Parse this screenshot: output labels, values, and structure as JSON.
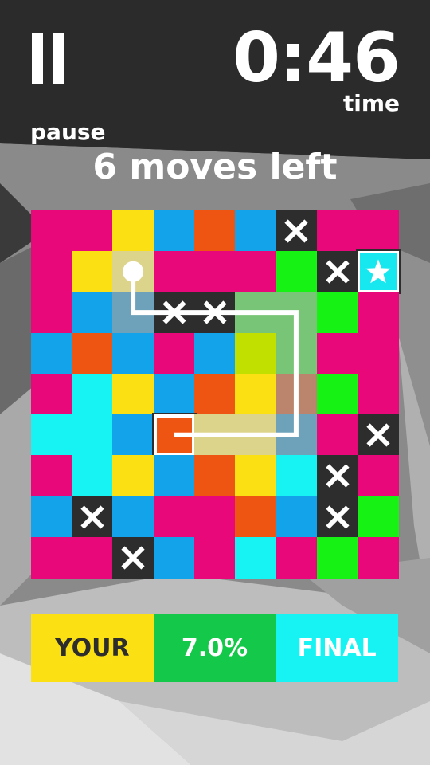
{
  "colors": {
    "pink": "#e8087a",
    "yellow": "#fbe014",
    "blue": "#12a3ea",
    "orange": "#ef5512",
    "green": "#15f214",
    "cyan": "#17f3f3",
    "dark": "#2d2d2d",
    "lime": "#c2e000"
  },
  "hud": {
    "pause_label": "pause",
    "timer_value": "0:46",
    "timer_label": "time",
    "moves_text": "6 moves left"
  },
  "board": {
    "size": 9,
    "rows": [
      [
        "pink",
        "pink",
        "yellow",
        "blue",
        "orange",
        "blue",
        "x",
        "pink",
        "pink"
      ],
      [
        "pink",
        "yellow",
        "yellow",
        "pink",
        "pink",
        "pink",
        "green",
        "x",
        "star"
      ],
      [
        "pink",
        "blue",
        "blue",
        "x",
        "x",
        "green",
        "green",
        "green",
        "pink"
      ],
      [
        "blue",
        "orange",
        "blue",
        "pink",
        "blue",
        "lime",
        "green",
        "pink",
        "pink"
      ],
      [
        "pink",
        "cyan",
        "yellow",
        "blue",
        "orange",
        "yellow",
        "orange",
        "green",
        "pink"
      ],
      [
        "cyan",
        "cyan",
        "blue",
        "orange",
        "yellow",
        "yellow",
        "blue",
        "pink",
        "x"
      ],
      [
        "pink",
        "cyan",
        "yellow",
        "blue",
        "orange",
        "yellow",
        "cyan",
        "x",
        "pink"
      ],
      [
        "blue",
        "x",
        "blue",
        "pink",
        "pink",
        "orange",
        "blue",
        "x",
        "green"
      ],
      [
        "pink",
        "pink",
        "x",
        "blue",
        "pink",
        "cyan",
        "pink",
        "green",
        "pink"
      ]
    ],
    "path": [
      [
        2,
        1
      ],
      [
        2,
        2
      ],
      [
        3,
        2
      ],
      [
        4,
        2
      ],
      [
        5,
        2
      ],
      [
        6,
        2
      ],
      [
        6,
        3
      ],
      [
        6,
        4
      ],
      [
        6,
        5
      ],
      [
        5,
        5
      ],
      [
        4,
        5
      ],
      [
        3,
        5
      ]
    ],
    "target_cell": [
      3,
      5
    ]
  },
  "score_bar": {
    "left_label": "YOUR",
    "center_label": "7.0%",
    "right_label": "FINAL",
    "left_color": "#fbe014",
    "center_color": "#14c84a",
    "right_color": "#17f3f3",
    "left_text_color": "#2d2d2d",
    "center_text_color": "#ffffff",
    "right_text_color": "#ffffff"
  }
}
